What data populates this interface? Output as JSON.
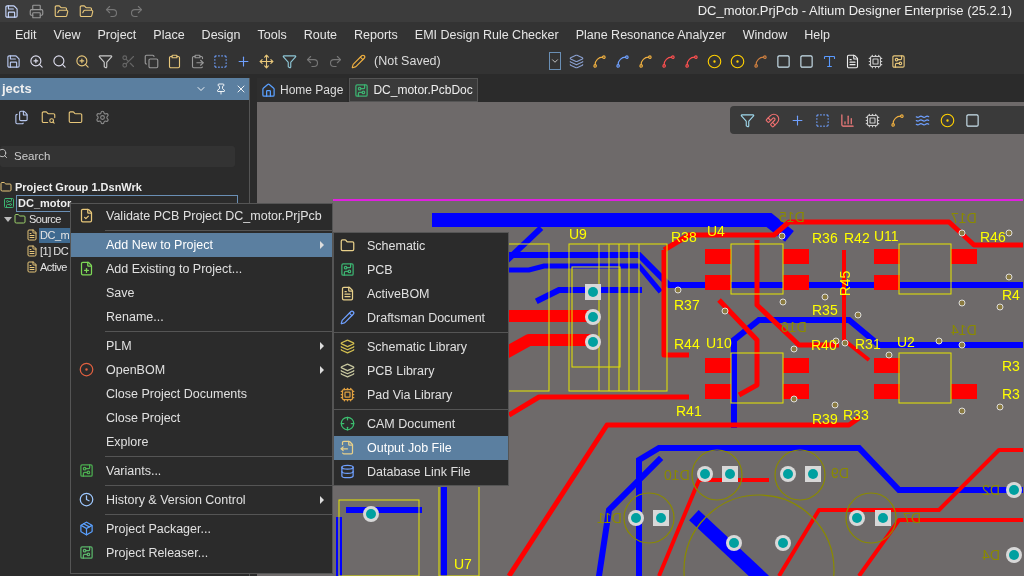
{
  "window": {
    "title": "DC_motor.PrjPcb - Altium Designer Enterprise (25.2.1)"
  },
  "menu_bar": [
    "Edit",
    "View",
    "Project",
    "Place",
    "Design",
    "Tools",
    "Route",
    "Reports",
    "EMI Design Rule Checker",
    "Plane Resonance Analyzer",
    "Window",
    "Help"
  ],
  "toolbar": {
    "status": "(Not Saved)"
  },
  "projects_panel": {
    "title": "jects",
    "search": {
      "placeholder": "Search"
    },
    "tree": [
      {
        "label": "Project Group 1.DsnWrk",
        "selected": false,
        "focused": false,
        "children": [
          {
            "label": "DC_motor",
            "selected": false,
            "focused": true,
            "children": [
              {
                "label": "Source",
                "selected": false,
                "focused": false,
                "expanded": true,
                "children": [
                  {
                    "label": "DC_m",
                    "selected": true,
                    "focused": false
                  },
                  {
                    "label": "[1] DC",
                    "selected": false,
                    "focused": false
                  },
                  {
                    "label": "Active",
                    "selected": false,
                    "focused": false
                  }
                ]
              }
            ]
          }
        ]
      }
    ]
  },
  "tabs": [
    {
      "label": "Home Page",
      "selected": false
    },
    {
      "label": "DC_motor.PcbDoc",
      "selected": true
    }
  ],
  "context_menu": {
    "groups": [
      [
        {
          "label": "Validate PCB Project DC_motor.PrjPcb",
          "submenu": false,
          "selected": false
        }
      ],
      [
        {
          "label": "Add New to Project",
          "submenu": true,
          "selected": true
        },
        {
          "label": "Add Existing to Project...",
          "submenu": false,
          "selected": false
        },
        {
          "label": "Save",
          "submenu": false,
          "selected": false
        },
        {
          "label": "Rename...",
          "submenu": false,
          "selected": false
        }
      ],
      [
        {
          "label": "PLM",
          "submenu": true,
          "selected": false
        },
        {
          "label": "OpenBOM",
          "submenu": true,
          "selected": false
        },
        {
          "label": "Close Project Documents",
          "submenu": false,
          "selected": false
        },
        {
          "label": "Close Project",
          "submenu": false,
          "selected": false
        },
        {
          "label": "Explore",
          "submenu": false,
          "selected": false
        }
      ],
      [
        {
          "label": "Variants...",
          "submenu": false,
          "selected": false
        }
      ],
      [
        {
          "label": "History & Version Control",
          "submenu": true,
          "selected": false
        }
      ],
      [
        {
          "label": "Project Packager...",
          "submenu": false,
          "selected": false
        },
        {
          "label": "Project Releaser...",
          "submenu": false,
          "selected": false
        }
      ]
    ]
  },
  "submenu": {
    "groups": [
      [
        {
          "label": "Schematic",
          "selected": false
        },
        {
          "label": "PCB",
          "selected": false
        },
        {
          "label": "ActiveBOM",
          "selected": false
        },
        {
          "label": "Draftsman Document",
          "selected": false
        }
      ],
      [
        {
          "label": "Schematic Library",
          "selected": false
        },
        {
          "label": "PCB Library",
          "selected": false
        },
        {
          "label": "Pad Via Library",
          "selected": false
        }
      ],
      [
        {
          "label": "CAM Document",
          "selected": false
        },
        {
          "label": "Output Job File",
          "selected": true
        },
        {
          "label": "Database Link File",
          "selected": false
        }
      ]
    ]
  },
  "pcb": {
    "designators": [
      {
        "label": "U9",
        "mirrored": false
      },
      {
        "label": "R38",
        "mirrored": false
      },
      {
        "label": "U4",
        "mirrored": false
      },
      {
        "label": "R36",
        "mirrored": false
      },
      {
        "label": "R42",
        "mirrored": false
      },
      {
        "label": "U11",
        "mirrored": false
      },
      {
        "label": "R46",
        "mirrored": false
      },
      {
        "label": "R37",
        "mirrored": false
      },
      {
        "label": "R35",
        "mirrored": false
      },
      {
        "label": "R45",
        "mirrored": false
      },
      {
        "label": "R4",
        "mirrored": false
      },
      {
        "label": "R44",
        "mirrored": false
      },
      {
        "label": "U10",
        "mirrored": false
      },
      {
        "label": "R40",
        "mirrored": false
      },
      {
        "label": "R31",
        "mirrored": false
      },
      {
        "label": "U2",
        "mirrored": false
      },
      {
        "label": "R3",
        "mirrored": false
      },
      {
        "label": "R3",
        "mirrored": false
      },
      {
        "label": "R41",
        "mirrored": false
      },
      {
        "label": "R39",
        "mirrored": false
      },
      {
        "label": "R33",
        "mirrored": false
      },
      {
        "label": "U7",
        "mirrored": false
      },
      {
        "label": "D15",
        "mirrored": true
      },
      {
        "label": "D17",
        "mirrored": true
      },
      {
        "label": "D16",
        "mirrored": true
      },
      {
        "label": "D14",
        "mirrored": true
      },
      {
        "label": "D10",
        "mirrored": true
      },
      {
        "label": "D9",
        "mirrored": true
      },
      {
        "label": "D11",
        "mirrored": true
      },
      {
        "label": "D7",
        "mirrored": true
      },
      {
        "label": "D2",
        "mirrored": true
      },
      {
        "label": "D4",
        "mirrored": true
      }
    ]
  }
}
